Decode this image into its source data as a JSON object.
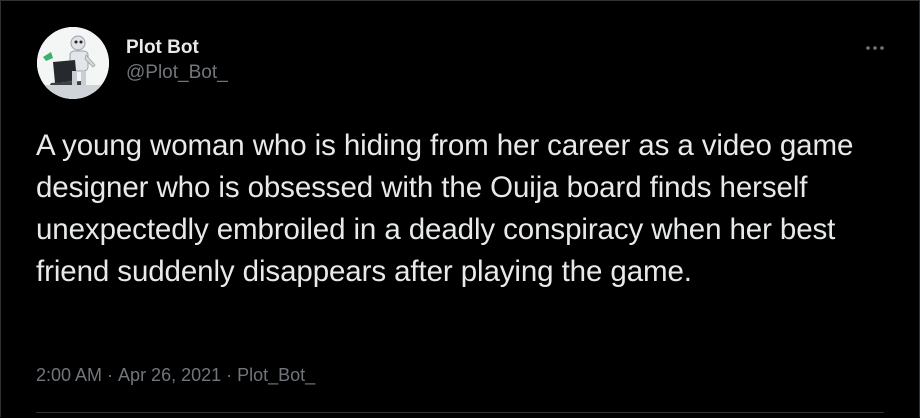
{
  "tweet": {
    "author": {
      "display_name": "Plot Bot",
      "handle": "@Plot_Bot_",
      "avatar_icon": "robot-at-laptop-avatar"
    },
    "more_icon": "more-horizontal-icon",
    "text": "A young woman who is hiding from her career as a video game designer who is obsessed with the Ouija board finds herself unexpectedly embroiled in a deadly conspiracy when her best friend suddenly disappears after playing the game.",
    "time": "2:00 AM",
    "separator": "·",
    "date": "Apr 26, 2021",
    "source": "Plot_Bot_"
  },
  "colors": {
    "background": "#000000",
    "primary_text": "#e7e9ea",
    "secondary_text": "#71767b",
    "border": "#2f3336"
  }
}
